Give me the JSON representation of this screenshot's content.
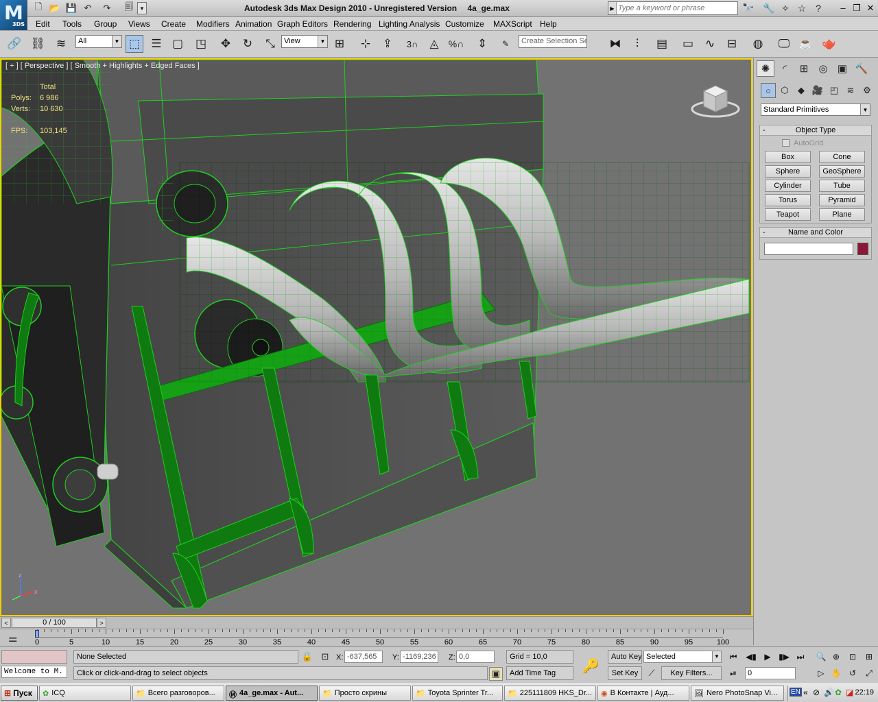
{
  "title": {
    "app_name": "Autodesk 3ds Max Design 2010",
    "status": "Unregistered Version",
    "file": "4a_ge.max",
    "logo_text": "3DS",
    "search_placeholder": "Type a keyword or phrase"
  },
  "menu": [
    "Edit",
    "Tools",
    "Group",
    "Views",
    "Create",
    "Modifiers",
    "Animation",
    "Graph Editors",
    "Rendering",
    "Lighting Analysis",
    "Customize",
    "MAXScript",
    "Help"
  ],
  "toolbar": {
    "selection_filter": "All",
    "reference_coord": "View",
    "snap_3d": "3",
    "percent": "%",
    "named_selection_placeholder": "Create Selection Se"
  },
  "viewport": {
    "label": "[ + ] [ Perspective ] [ Smooth + Highlights + Edged Faces ]",
    "stats": {
      "total_label": "Total",
      "polys_label": "Polys:",
      "polys_value": "6 986",
      "verts_label": "Verts:",
      "verts_value": "10 630",
      "fps_label": "FPS:",
      "fps_value": "103,145"
    },
    "axes": {
      "z": "z",
      "x": "x"
    },
    "colors": {
      "background": "#727272",
      "wire": "#1fd01f",
      "border": "#f2d000"
    }
  },
  "command_panel": {
    "category": "Standard Primitives",
    "object_type_title": "Object Type",
    "autogrid_label": "AutoGrid",
    "primitives": [
      "Box",
      "Cone",
      "Sphere",
      "GeoSphere",
      "Cylinder",
      "Tube",
      "Torus",
      "Pyramid",
      "Teapot",
      "Plane"
    ],
    "name_color_title": "Name and Color",
    "object_color": "#8a1838"
  },
  "timeline": {
    "frame_display": "0 / 100",
    "ticks": [
      0,
      5,
      10,
      15,
      20,
      25,
      30,
      35,
      40,
      45,
      50,
      55,
      60,
      65,
      70,
      75,
      80,
      85,
      90,
      95,
      100
    ],
    "current_frame": 0,
    "total_frames": 100
  },
  "status": {
    "maxscript_listener": "Welcome to M.",
    "selection": "None Selected",
    "prompt": "Click or click-and-drag to select objects",
    "x_label": "X:",
    "x_value": "-637,565",
    "y_label": "Y:",
    "y_value": "-1169,236",
    "z_label": "Z:",
    "z_value": "0,0",
    "grid": "Grid = 10,0",
    "add_time_tag": "Add Time Tag",
    "auto_key": "Auto Key",
    "set_key": "Set Key",
    "selected_set": "Selected",
    "key_filters": "Key Filters...",
    "frame_value": "0"
  },
  "taskbar": {
    "start": "Пуск",
    "tasks": [
      "ICQ",
      "Всего разговоров...",
      "4a_ge.max - Aut...",
      "Просто скрины",
      "Toyota Sprinter Tr...",
      "225111809 HKS_Dr...",
      "В Контакте | Ауд...",
      "Nero PhotoSnap Vi..."
    ],
    "lang": "EN",
    "clock": "22:19"
  }
}
